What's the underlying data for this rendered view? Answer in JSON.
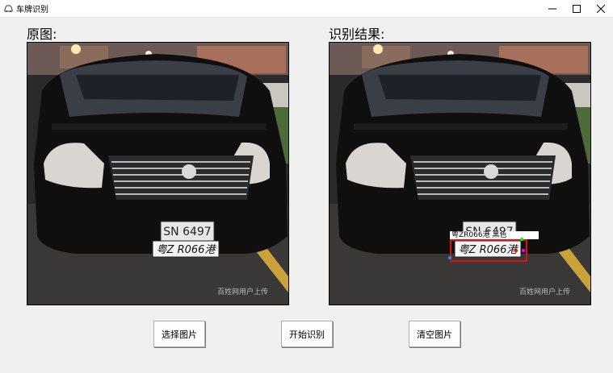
{
  "window": {
    "title": "车牌识别",
    "icon": "car-icon",
    "controls": [
      "minimize-icon",
      "maximize-icon",
      "close-icon"
    ]
  },
  "labels": {
    "original": "原图:",
    "result": "识别结果:"
  },
  "image": {
    "plate_top": "SN 6497",
    "plate_bottom": "粤Z R066港",
    "watermark": "百姓网用户上传"
  },
  "recognition": {
    "text": "粤ZR066港 黑色",
    "box_color": "#e01010",
    "keypoint_colors": [
      "#00a0ff",
      "#00ff00",
      "#ff00ff",
      "#ff0000"
    ]
  },
  "buttons": {
    "select": "选择图片",
    "start": "开始识别",
    "clear": "清空图片"
  }
}
